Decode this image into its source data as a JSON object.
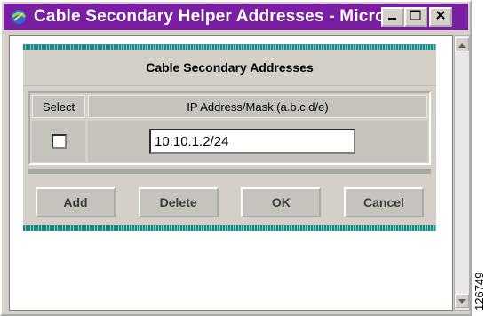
{
  "window": {
    "title": "Cable Secondary Helper Addresses - Micro..."
  },
  "panel": {
    "heading": "Cable Secondary Addresses",
    "columns": {
      "select": "Select",
      "ip": "IP Address/Mask (a.b.c.d/e)"
    },
    "row": {
      "selected": false,
      "ip_value": "10.10.1.2/24"
    }
  },
  "buttons": {
    "add": "Add",
    "delete": "Delete",
    "ok": "OK",
    "cancel": "Cancel"
  },
  "figure_id": "126749",
  "colors": {
    "titlebar": "#7b1fa2",
    "accent_bar": "#1a8a86",
    "panel_bg": "#d4d0c8"
  },
  "icons": [
    "app-icon",
    "minimize-icon",
    "maximize-icon",
    "close-icon",
    "scroll-up-icon",
    "scroll-down-icon"
  ]
}
